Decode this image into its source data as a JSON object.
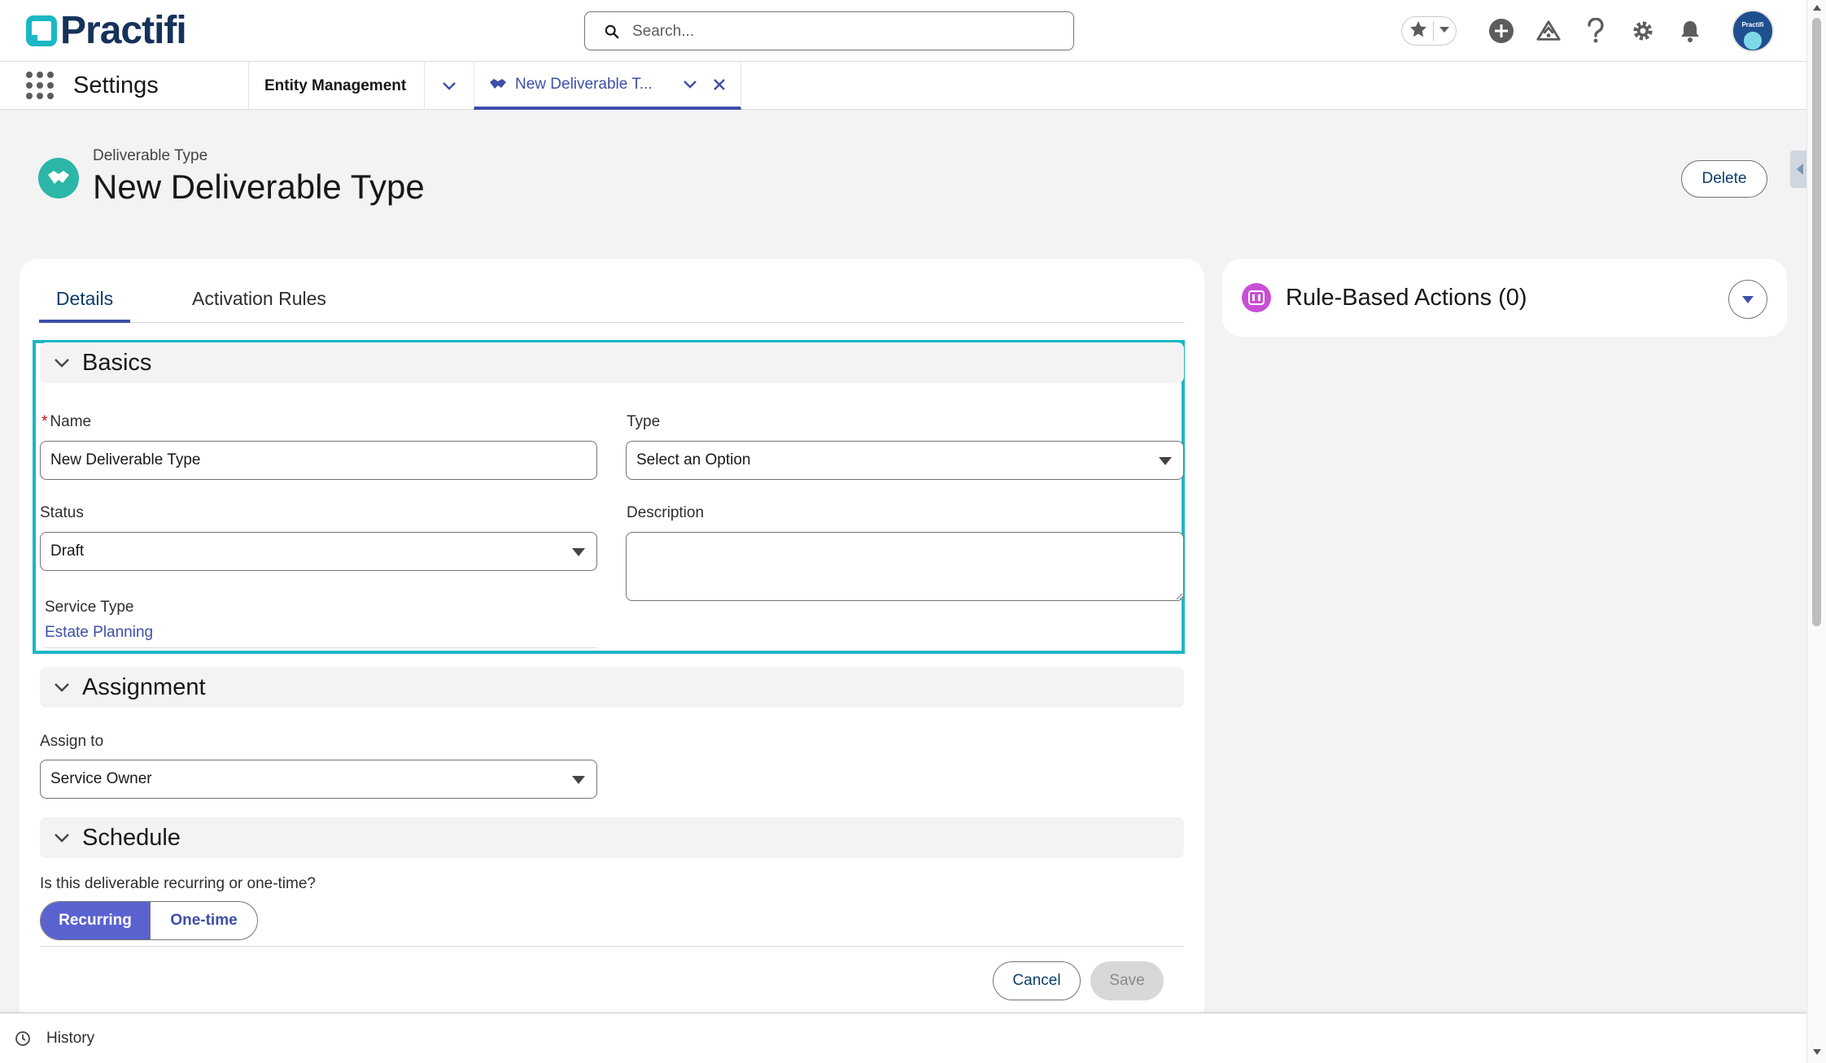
{
  "header": {
    "logo_text": "Practifi",
    "search_placeholder": "Search...",
    "avatar_text": "Practifi",
    "icons": [
      "favorites-star-icon",
      "chevron-down-icon",
      "add-icon",
      "trailhead-icon",
      "help-icon",
      "gear-icon",
      "bell-icon"
    ]
  },
  "nav": {
    "app_name": "Settings",
    "tabs": [
      {
        "label": "Entity Management"
      },
      {
        "label": "New Deliverable T..."
      }
    ]
  },
  "record": {
    "type_label": "Deliverable Type",
    "title": "New Deliverable Type",
    "delete_label": "Delete"
  },
  "main": {
    "tabs": [
      {
        "label": "Details"
      },
      {
        "label": "Activation Rules"
      }
    ],
    "sections": {
      "basics": {
        "title": "Basics",
        "name_label": "Name",
        "name_value": "New Deliverable Type",
        "type_label": "Type",
        "type_value": "Select an Option",
        "status_label": "Status",
        "status_value": "Draft",
        "description_label": "Description",
        "description_value": "",
        "service_type_label": "Service Type",
        "service_type_value": "Estate Planning"
      },
      "assignment": {
        "title": "Assignment",
        "assign_label": "Assign to",
        "assign_value": "Service Owner"
      },
      "schedule": {
        "title": "Schedule",
        "question": "Is this deliverable recurring or one-time?",
        "options": [
          "Recurring",
          "One-time"
        ],
        "selected": "Recurring"
      }
    },
    "cancel_label": "Cancel",
    "save_label": "Save"
  },
  "side_panel": {
    "title": "Rule-Based Actions (0)"
  },
  "utility": {
    "history_label": "History"
  },
  "colors": {
    "brand_teal": "#1bb7c4",
    "brand_navy": "#16325c",
    "accent_blue": "#3c4fa8",
    "toggle_active": "#5a62d0",
    "rba_icon": "#c94fd6",
    "record_icon": "#2bb6a8"
  }
}
